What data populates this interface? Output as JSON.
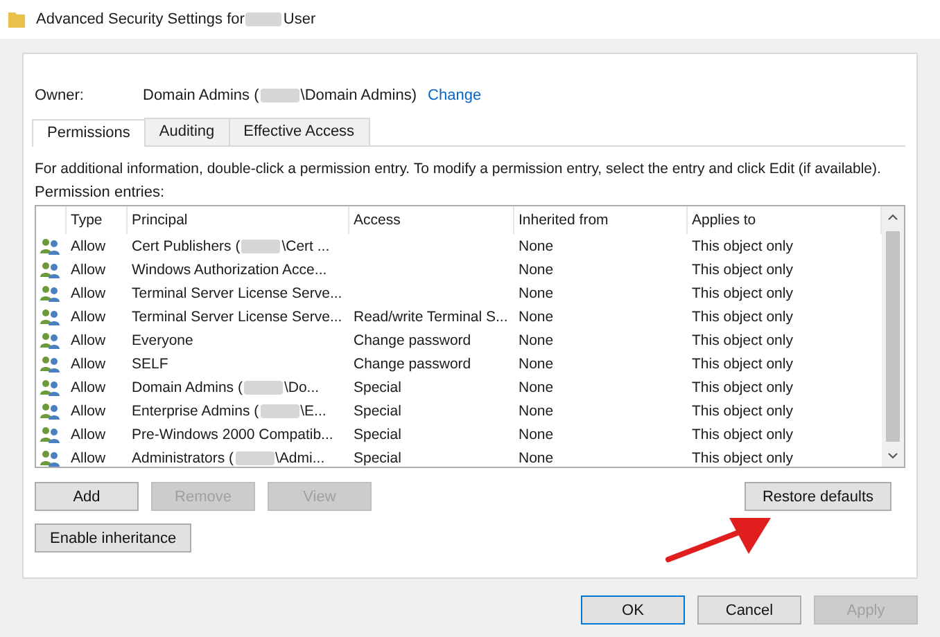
{
  "window": {
    "title": [
      "Advanced Security Settings for",
      "User"
    ]
  },
  "owner": {
    "label": "Owner:",
    "value": [
      "Domain Admins (",
      "\\Domain Admins)"
    ],
    "link": "Change"
  },
  "tabs": [
    {
      "label": "Permissions",
      "selected": true
    },
    {
      "label": "Auditing",
      "selected": false
    },
    {
      "label": "Effective Access",
      "selected": false
    }
  ],
  "info": "For additional information, double-click a permission entry. To modify a permission entry, select the entry and click Edit (if available).",
  "entries_label": "Permission entries:",
  "table": {
    "columns": [
      "Type",
      "Principal",
      "Access",
      "Inherited from",
      "Applies to"
    ],
    "rows": [
      {
        "type": "Allow",
        "principal": [
          "Cert Publishers (",
          "\\Cert ..."
        ],
        "access": "",
        "inherited": "None",
        "applies": "This object only"
      },
      {
        "type": "Allow",
        "principal": [
          "Windows Authorization Acce..."
        ],
        "access": "",
        "inherited": "None",
        "applies": "This object only"
      },
      {
        "type": "Allow",
        "principal": [
          "Terminal Server License Serve..."
        ],
        "access": "",
        "inherited": "None",
        "applies": "This object only"
      },
      {
        "type": "Allow",
        "principal": [
          "Terminal Server License Serve..."
        ],
        "access": "Read/write Terminal S...",
        "inherited": "None",
        "applies": "This object only"
      },
      {
        "type": "Allow",
        "principal": [
          "Everyone"
        ],
        "access": "Change password",
        "inherited": "None",
        "applies": "This object only"
      },
      {
        "type": "Allow",
        "principal": [
          "SELF"
        ],
        "access": "Change password",
        "inherited": "None",
        "applies": "This object only"
      },
      {
        "type": "Allow",
        "principal": [
          "Domain Admins (",
          "\\Do..."
        ],
        "access": "Special",
        "inherited": "None",
        "applies": "This object only"
      },
      {
        "type": "Allow",
        "principal": [
          "Enterprise Admins (",
          "\\E..."
        ],
        "access": "Special",
        "inherited": "None",
        "applies": "This object only"
      },
      {
        "type": "Allow",
        "principal": [
          "Pre-Windows 2000 Compatib..."
        ],
        "access": "Special",
        "inherited": "None",
        "applies": "This object only"
      },
      {
        "type": "Allow",
        "principal": [
          "Administrators (",
          "\\Admi..."
        ],
        "access": "Special",
        "inherited": "None",
        "applies": "This object only"
      }
    ]
  },
  "entry_buttons": [
    {
      "label": "Add",
      "disabled": false
    },
    {
      "label": "Remove",
      "disabled": true
    },
    {
      "label": "View",
      "disabled": true
    }
  ],
  "restore_button": {
    "label": "Restore defaults",
    "disabled": false
  },
  "inheritance_button": {
    "label": "Enable inheritance",
    "disabled": false
  },
  "dialog_buttons": [
    {
      "label": "OK",
      "disabled": false,
      "default": true
    },
    {
      "label": "Cancel",
      "disabled": false,
      "default": false
    },
    {
      "label": "Apply",
      "disabled": true,
      "default": false
    }
  ]
}
